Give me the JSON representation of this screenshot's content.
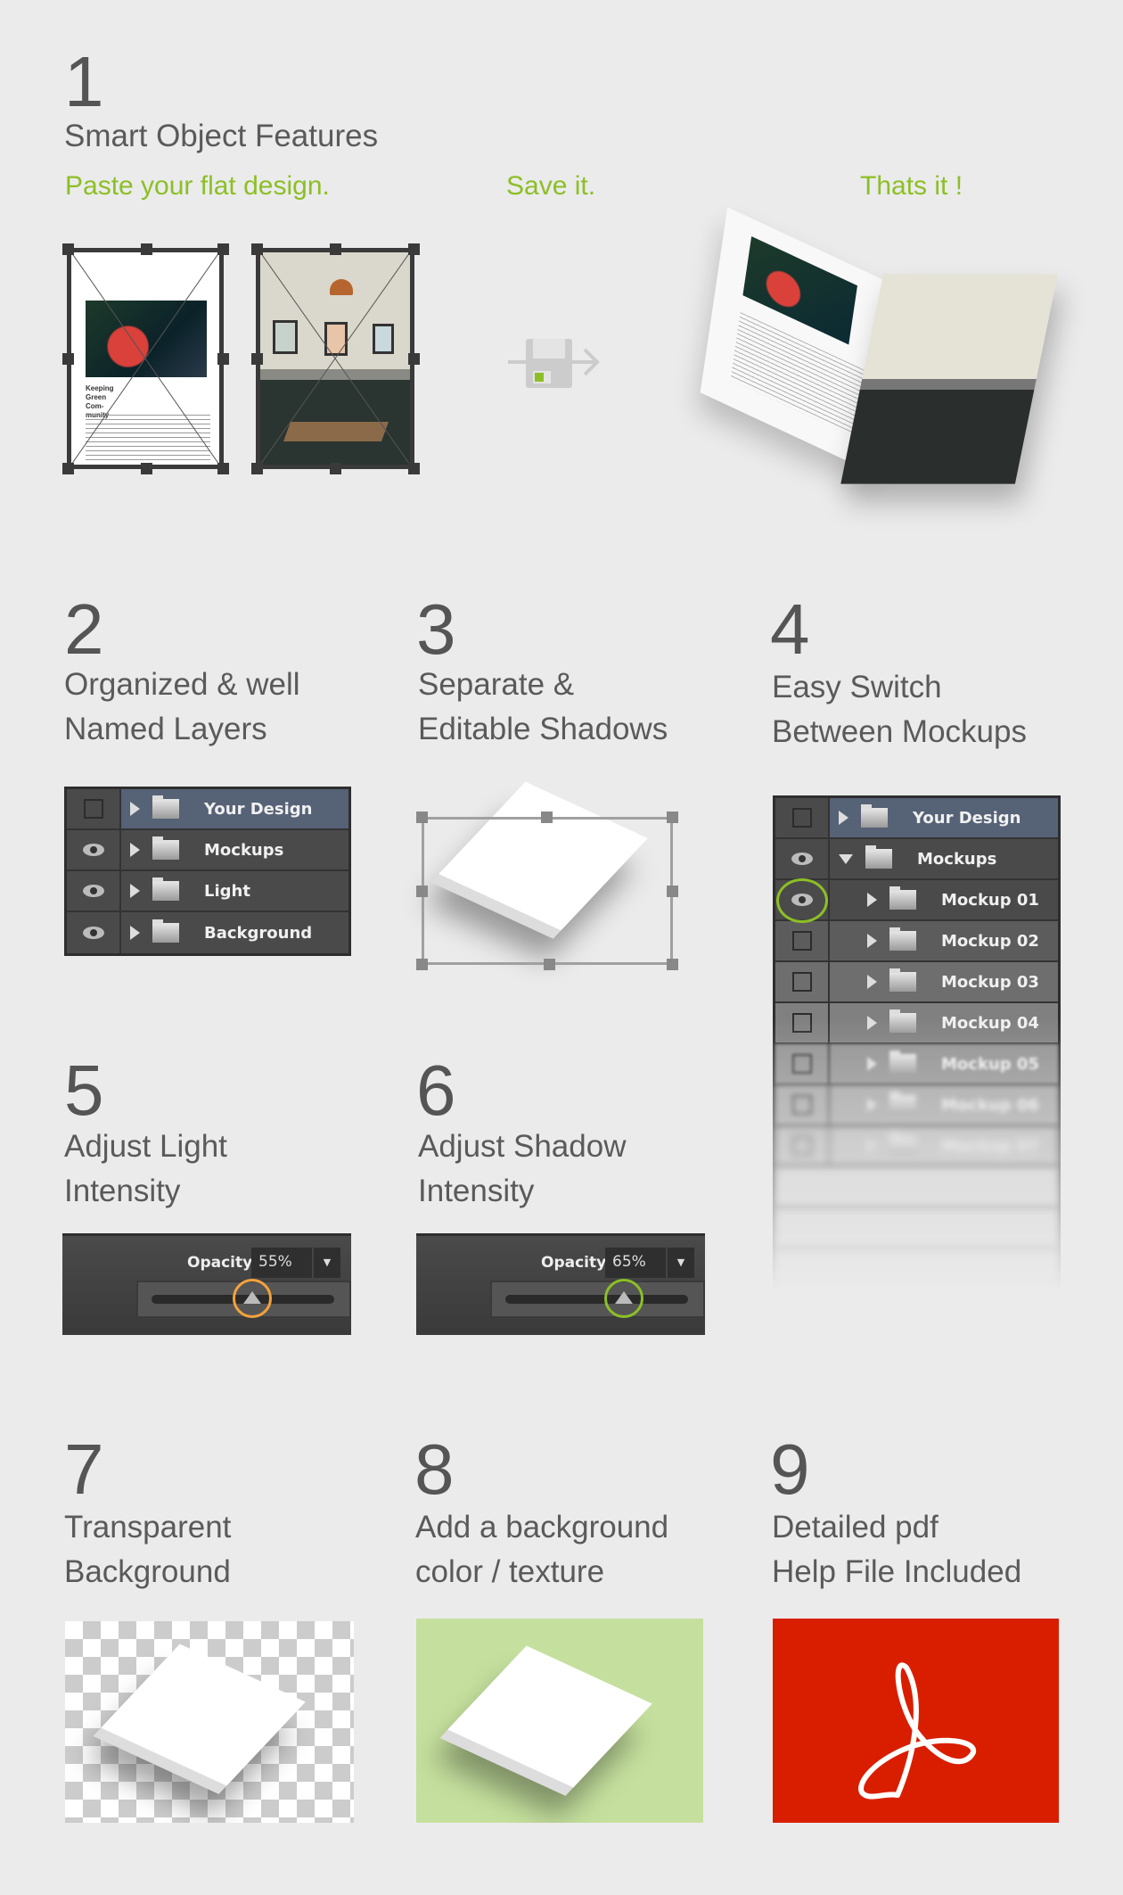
{
  "sections": [
    {
      "number": "1",
      "title": "Smart Object Features"
    },
    {
      "number": "2",
      "title_lines": [
        "Organized & well",
        "Named Layers"
      ]
    },
    {
      "number": "3",
      "title_lines": [
        "Separate &",
        "Editable Shadows"
      ]
    },
    {
      "number": "4",
      "title_lines": [
        "Easy Switch",
        "Between Mockups"
      ]
    },
    {
      "number": "5",
      "title_lines": [
        "Adjust Light",
        "Intensity"
      ]
    },
    {
      "number": "6",
      "title_lines": [
        "Adjust Shadow",
        "Intensity"
      ]
    },
    {
      "number": "7",
      "title_lines": [
        "Transparent",
        "Background"
      ]
    },
    {
      "number": "8",
      "title_lines": [
        "Add a background",
        "color / texture"
      ]
    },
    {
      "number": "9",
      "title_lines": [
        "Detailed pdf",
        "Help File Included"
      ]
    }
  ],
  "steps": [
    "Paste your flat design.",
    "Save it.",
    "Thats it !"
  ],
  "magazine": {
    "headline": "Keeping Green Com- munity"
  },
  "layers_panel": [
    "Your Design",
    "Mockups",
    "Light",
    "Background"
  ],
  "mockups_panel": {
    "top": [
      "Your Design",
      "Mockups"
    ],
    "children": [
      "Mockup 01",
      "Mockup 02",
      "Mockup 03",
      "Mockup 04",
      "Mockup 05",
      "Mockup 06",
      "Mockup 07"
    ]
  },
  "light_opacity": {
    "label": "Opacity:",
    "value": "55%",
    "percent": 55
  },
  "shadow_opacity": {
    "label": "Opacity:",
    "value": "65%",
    "percent": 65
  },
  "colors": {
    "accent_green": "#8cbf26",
    "highlight_orange": "#f4a23c",
    "background_green": "#c5e09e",
    "pdf_red": "#d91e00"
  }
}
